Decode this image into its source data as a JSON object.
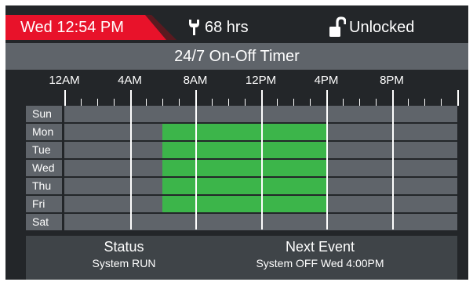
{
  "header": {
    "clock": "Wed 12:54 PM",
    "hours": "68 hrs",
    "hours_icon": "wrench-icon",
    "lock_status": "Unlocked",
    "lock_icon": "unlocked-padlock-icon",
    "accent_color": "#e8122a"
  },
  "title": "24/7 On-Off Timer",
  "timer": {
    "hour_labels": [
      "12AM",
      "4AM",
      "8AM",
      "12PM",
      "4PM",
      "8PM"
    ],
    "days": [
      {
        "label": "Sun",
        "on": []
      },
      {
        "label": "Mon",
        "on": [
          [
            6,
            16
          ]
        ]
      },
      {
        "label": "Tue",
        "on": [
          [
            6,
            16
          ]
        ]
      },
      {
        "label": "Wed",
        "on": [
          [
            6,
            16
          ]
        ]
      },
      {
        "label": "Thu",
        "on": [
          [
            6,
            16
          ]
        ]
      },
      {
        "label": "Fri",
        "on": [
          [
            6,
            16
          ]
        ]
      },
      {
        "label": "Sat",
        "on": []
      }
    ],
    "on_color": "#3cb54a"
  },
  "status": {
    "status_heading": "Status",
    "status_value": "System RUN",
    "next_heading": "Next Event",
    "next_value": "System OFF  Wed 4:00PM"
  }
}
